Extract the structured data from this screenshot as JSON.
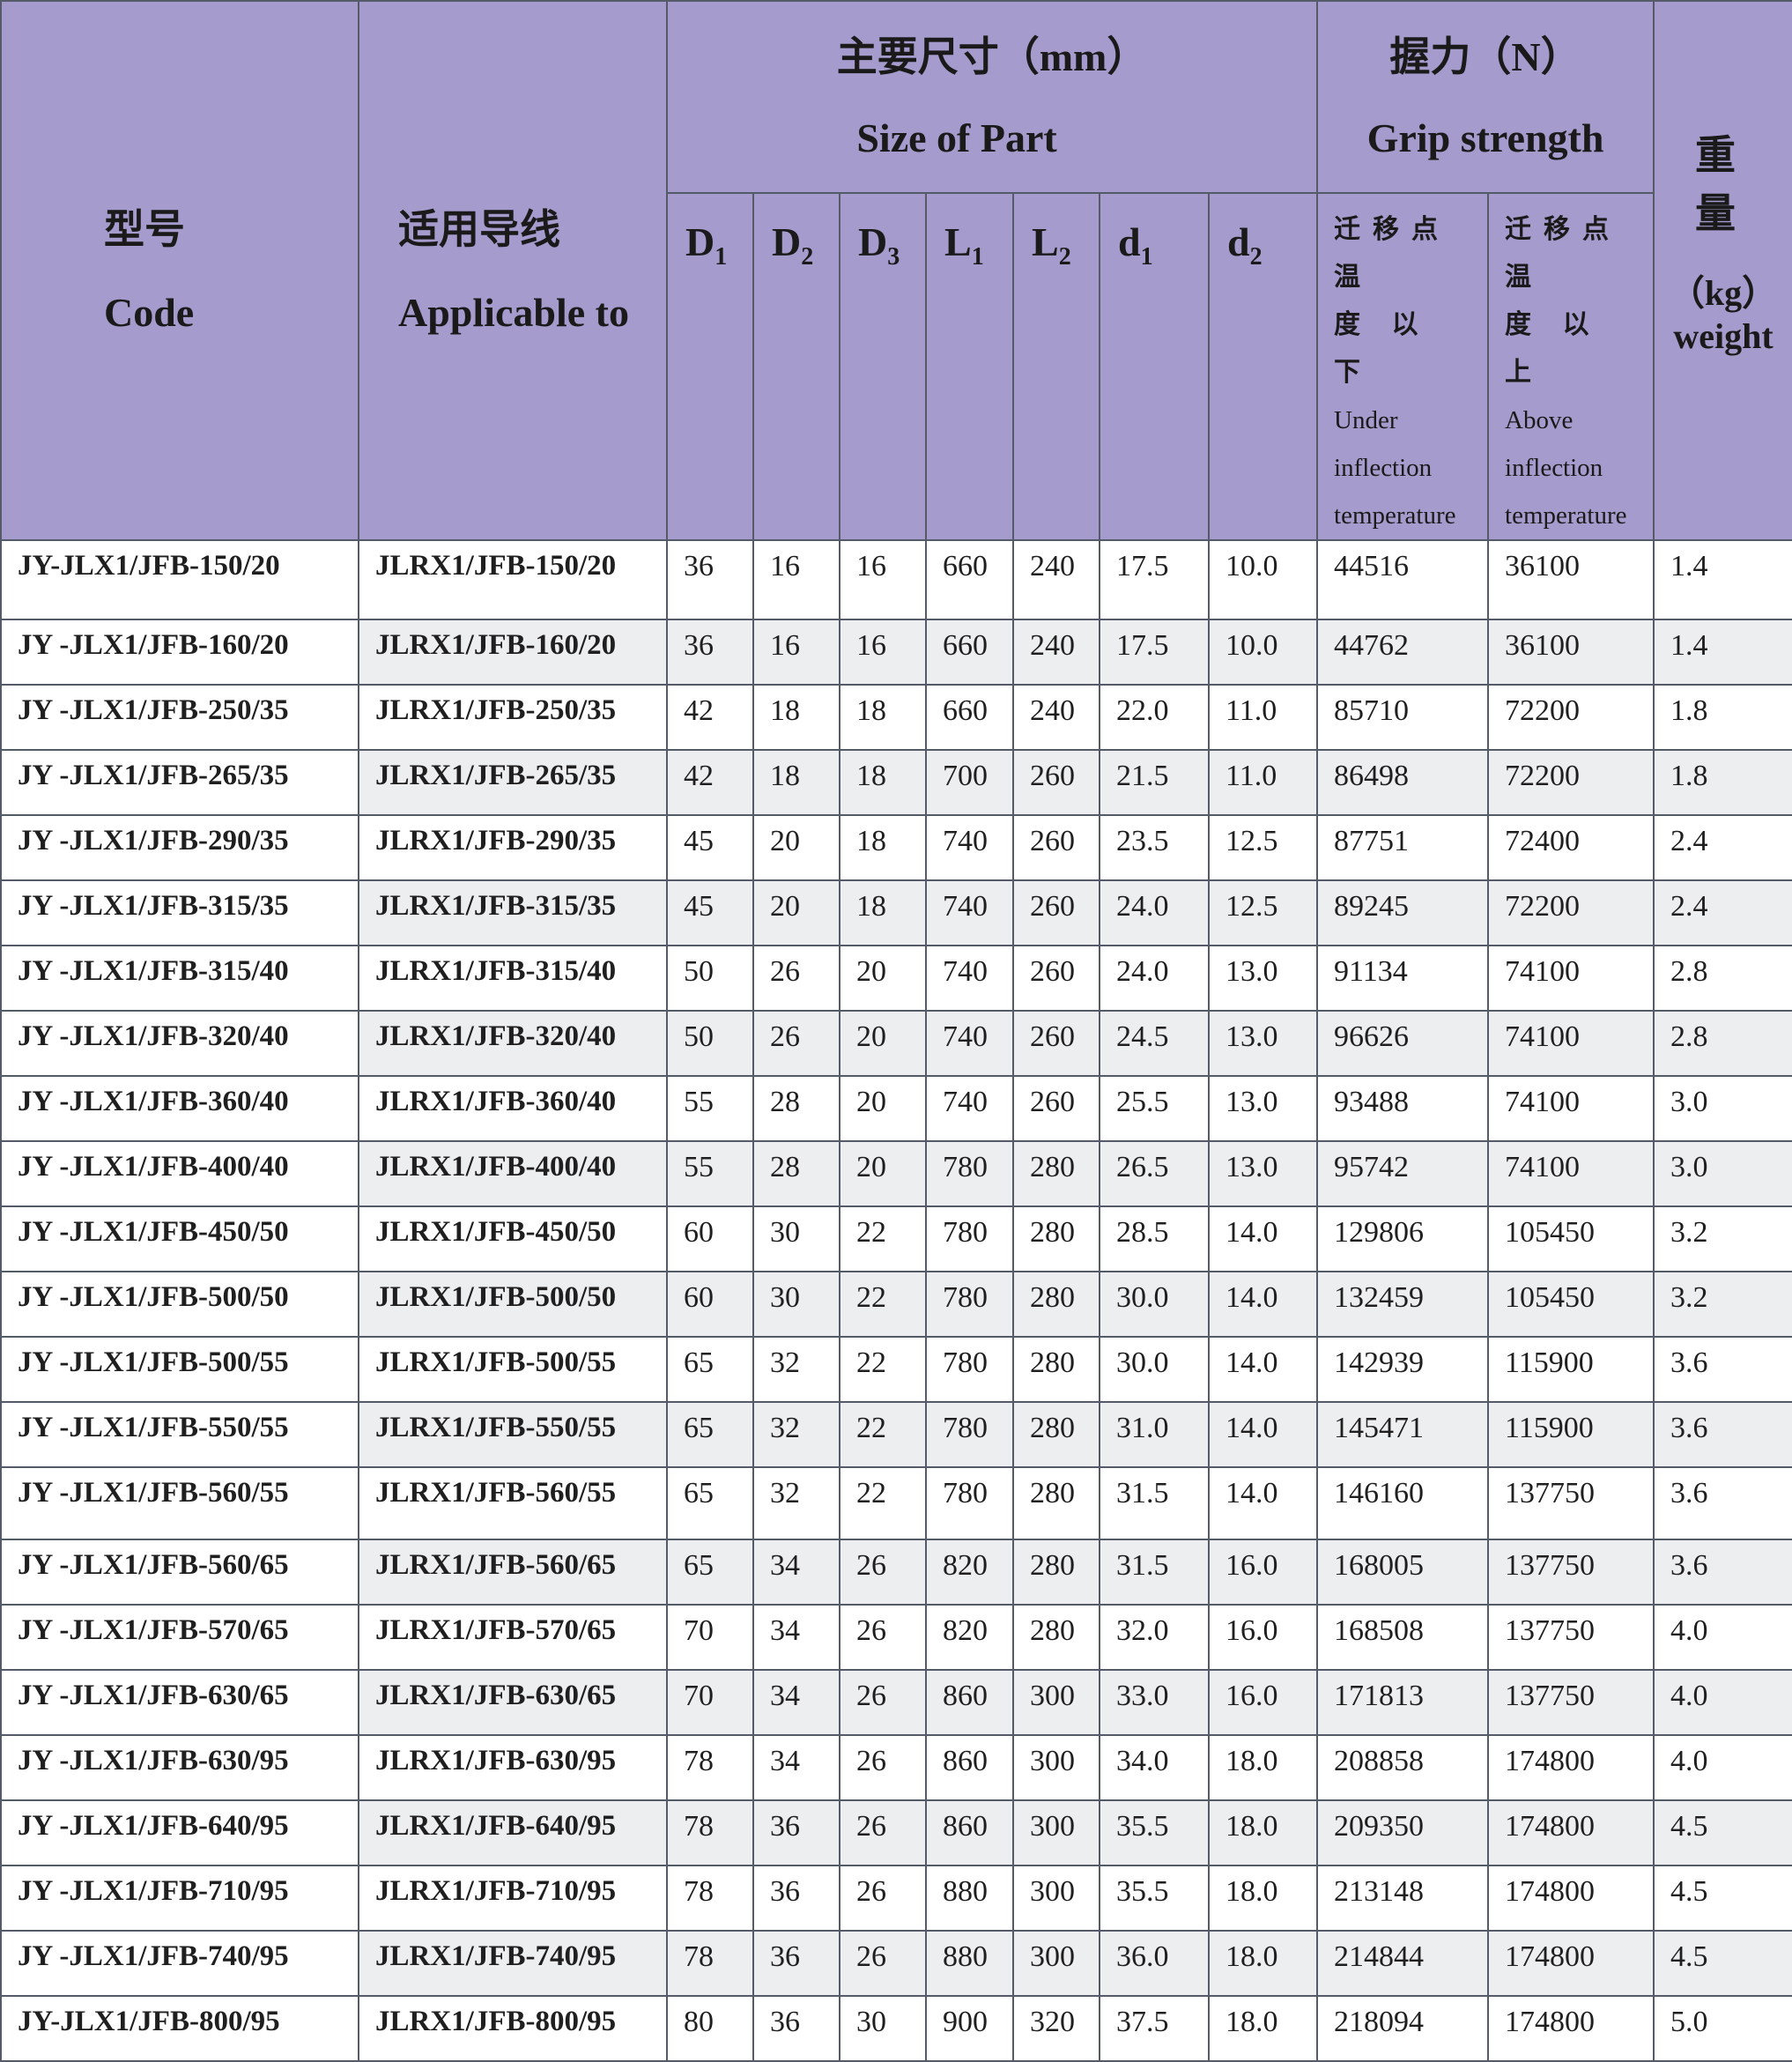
{
  "header": {
    "code_cn": "型号",
    "code_en": "Code",
    "applicable_cn": "适用导线",
    "applicable_en": "Applicable to",
    "size_cn": "主要尺寸（mm）",
    "size_en": "Size of Part",
    "grip_cn": "握力（N）",
    "grip_en": "Grip strength",
    "weight_cn": "重 量",
    "weight_unit": "（kg）",
    "weight_en": "weight",
    "dims": [
      {
        "base": "D",
        "sub": "1"
      },
      {
        "base": "D",
        "sub": "2"
      },
      {
        "base": "D",
        "sub": "3"
      },
      {
        "base": "L",
        "sub": "1"
      },
      {
        "base": "L",
        "sub": "2"
      },
      {
        "base": "d",
        "sub": "1"
      },
      {
        "base": "d",
        "sub": "2"
      }
    ],
    "under_cn_1": "迁移点温",
    "under_cn_2": "度 以 下",
    "under_en_1": "Under",
    "under_en_2": "inflection",
    "under_en_3": "temperature",
    "above_cn_1": "迁移点温",
    "above_cn_2": "度 以 上",
    "above_en_1": "Above",
    "above_en_2": "inflection",
    "above_en_3": "temperature"
  },
  "rows": [
    [
      "JY-JLX1/JFB-150/20",
      "JLRX1/JFB-150/20",
      "36",
      "16",
      "16",
      "660",
      "240",
      "17.5",
      "10.0",
      "44516",
      "36100",
      "1.4"
    ],
    [
      "JY -JLX1/JFB-160/20",
      "JLRX1/JFB-160/20",
      "36",
      "16",
      "16",
      "660",
      "240",
      "17.5",
      "10.0",
      "44762",
      "36100",
      "1.4"
    ],
    [
      "JY -JLX1/JFB-250/35",
      "JLRX1/JFB-250/35",
      "42",
      "18",
      "18",
      "660",
      "240",
      "22.0",
      "11.0",
      "85710",
      "72200",
      "1.8"
    ],
    [
      "JY -JLX1/JFB-265/35",
      "JLRX1/JFB-265/35",
      "42",
      "18",
      "18",
      "700",
      "260",
      "21.5",
      "11.0",
      "86498",
      "72200",
      "1.8"
    ],
    [
      "JY -JLX1/JFB-290/35",
      "JLRX1/JFB-290/35",
      "45",
      "20",
      "18",
      "740",
      "260",
      "23.5",
      "12.5",
      "87751",
      "72400",
      "2.4"
    ],
    [
      "JY -JLX1/JFB-315/35",
      "JLRX1/JFB-315/35",
      "45",
      "20",
      "18",
      "740",
      "260",
      "24.0",
      "12.5",
      "89245",
      "72200",
      "2.4"
    ],
    [
      "JY -JLX1/JFB-315/40",
      "JLRX1/JFB-315/40",
      "50",
      "26",
      "20",
      "740",
      "260",
      "24.0",
      "13.0",
      "91134",
      "74100",
      "2.8"
    ],
    [
      "JY -JLX1/JFB-320/40",
      "JLRX1/JFB-320/40",
      "50",
      "26",
      "20",
      "740",
      "260",
      "24.5",
      "13.0",
      "96626",
      "74100",
      "2.8"
    ],
    [
      "JY -JLX1/JFB-360/40",
      "JLRX1/JFB-360/40",
      "55",
      "28",
      "20",
      "740",
      "260",
      "25.5",
      "13.0",
      "93488",
      "74100",
      "3.0"
    ],
    [
      "JY -JLX1/JFB-400/40",
      "JLRX1/JFB-400/40",
      "55",
      "28",
      "20",
      "780",
      "280",
      "26.5",
      "13.0",
      "95742",
      "74100",
      "3.0"
    ],
    [
      "JY -JLX1/JFB-450/50",
      "JLRX1/JFB-450/50",
      "60",
      "30",
      "22",
      "780",
      "280",
      "28.5",
      "14.0",
      "129806",
      "105450",
      "3.2"
    ],
    [
      "JY -JLX1/JFB-500/50",
      "JLRX1/JFB-500/50",
      "60",
      "30",
      "22",
      "780",
      "280",
      "30.0",
      "14.0",
      "132459",
      "105450",
      "3.2"
    ],
    [
      "JY -JLX1/JFB-500/55",
      "JLRX1/JFB-500/55",
      "65",
      "32",
      "22",
      "780",
      "280",
      "30.0",
      "14.0",
      "142939",
      "115900",
      "3.6"
    ],
    [
      "JY -JLX1/JFB-550/55",
      "JLRX1/JFB-550/55",
      "65",
      "32",
      "22",
      "780",
      "280",
      "31.0",
      "14.0",
      "145471",
      "115900",
      "3.6"
    ],
    [
      "JY -JLX1/JFB-560/55",
      "JLRX1/JFB-560/55",
      "65",
      "32",
      "22",
      "780",
      "280",
      "31.5",
      "14.0",
      "146160",
      "137750",
      "3.6"
    ],
    [
      "JY -JLX1/JFB-560/65",
      "JLRX1/JFB-560/65",
      "65",
      "34",
      "26",
      "820",
      "280",
      "31.5",
      "16.0",
      "168005",
      "137750",
      "3.6"
    ],
    [
      "JY -JLX1/JFB-570/65",
      "JLRX1/JFB-570/65",
      "70",
      "34",
      "26",
      "820",
      "280",
      "32.0",
      "16.0",
      "168508",
      "137750",
      "4.0"
    ],
    [
      "JY -JLX1/JFB-630/65",
      "JLRX1/JFB-630/65",
      "70",
      "34",
      "26",
      "860",
      "300",
      "33.0",
      "16.0",
      "171813",
      "137750",
      "4.0"
    ],
    [
      "JY -JLX1/JFB-630/95",
      "JLRX1/JFB-630/95",
      "78",
      "34",
      "26",
      "860",
      "300",
      "34.0",
      "18.0",
      "208858",
      "174800",
      "4.0"
    ],
    [
      "JY -JLX1/JFB-640/95",
      "JLRX1/JFB-640/95",
      "78",
      "36",
      "26",
      "860",
      "300",
      "35.5",
      "18.0",
      "209350",
      "174800",
      "4.5"
    ],
    [
      "JY -JLX1/JFB-710/95",
      "JLRX1/JFB-710/95",
      "78",
      "36",
      "26",
      "880",
      "300",
      "35.5",
      "18.0",
      "213148",
      "174800",
      "4.5"
    ],
    [
      "JY -JLX1/JFB-740/95",
      "JLRX1/JFB-740/95",
      "78",
      "36",
      "26",
      "880",
      "300",
      "36.0",
      "18.0",
      "214844",
      "174800",
      "4.5"
    ],
    [
      "JY-JLX1/JFB-800/95",
      "JLRX1/JFB-800/95",
      "80",
      "36",
      "30",
      "900",
      "320",
      "37.5",
      "18.0",
      "218094",
      "174800",
      "5.0"
    ]
  ],
  "colors": {
    "header_bg": "#a59bcc",
    "alt_row_bg": "#edeef0",
    "border": "#555a68"
  }
}
